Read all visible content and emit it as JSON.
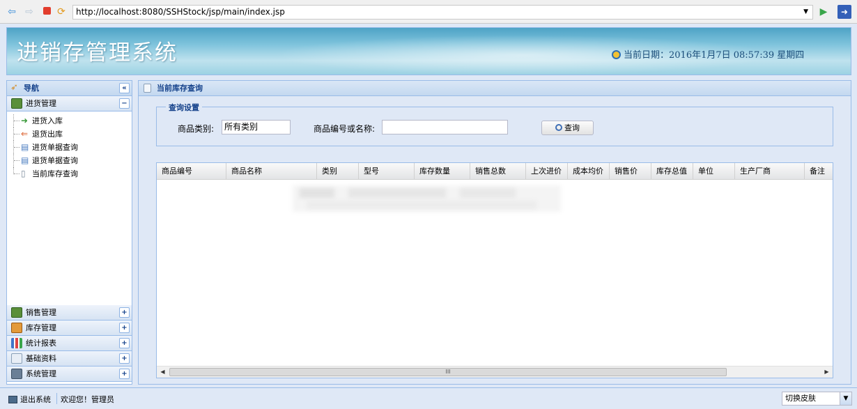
{
  "browser": {
    "url": "http://localhost:8080/SSHStock/jsp/main/index.jsp",
    "icons": [
      "back-icon",
      "forward-icon",
      "stop-icon",
      "refresh-icon",
      "go-icon",
      "home-icon"
    ]
  },
  "header": {
    "title": "进销存管理系统",
    "date_text": "当前日期：2016年1月7日 08:57:39 星期四"
  },
  "nav": {
    "title": "导航",
    "collapse_glyph": "«",
    "expanded_section": {
      "label": "进货管理",
      "toggle": "−",
      "items": [
        {
          "label": "进货入库",
          "icon": "import-icon"
        },
        {
          "label": "退货出库",
          "icon": "return-icon"
        },
        {
          "label": "进货单据查询",
          "icon": "doc-search-icon"
        },
        {
          "label": "退货单据查询",
          "icon": "doc-search-icon"
        },
        {
          "label": "当前库存查询",
          "icon": "doc-icon"
        }
      ]
    },
    "collapsed_sections": [
      {
        "label": "销售管理",
        "toggle": "+"
      },
      {
        "label": "库存管理",
        "toggle": "+"
      },
      {
        "label": "统计报表",
        "toggle": "+"
      },
      {
        "label": "基础资料",
        "toggle": "+"
      },
      {
        "label": "系统管理",
        "toggle": "+"
      }
    ]
  },
  "main": {
    "tab_title": "当前库存查询",
    "query": {
      "legend": "查询设置",
      "category_label": "商品类别:",
      "category_value": "所有类别",
      "keyword_label": "商品编号或名称:",
      "keyword_value": "",
      "search_button": "查询"
    },
    "grid": {
      "columns": [
        "商品编号",
        "商品名称",
        "类别",
        "型号",
        "库存数量",
        "销售总数",
        "上次进价",
        "成本均价",
        "销售价",
        "库存总值",
        "单位",
        "生产厂商",
        "备注"
      ],
      "rows": [],
      "scroll_glyph": "III"
    }
  },
  "status": {
    "logout": "退出系统",
    "welcome": "欢迎您！管理员",
    "skin_value": "切换皮肤"
  },
  "colors": {
    "border": "#99bbe8",
    "panel_bg": "#dfe8f6",
    "header_text": "#15428b"
  }
}
